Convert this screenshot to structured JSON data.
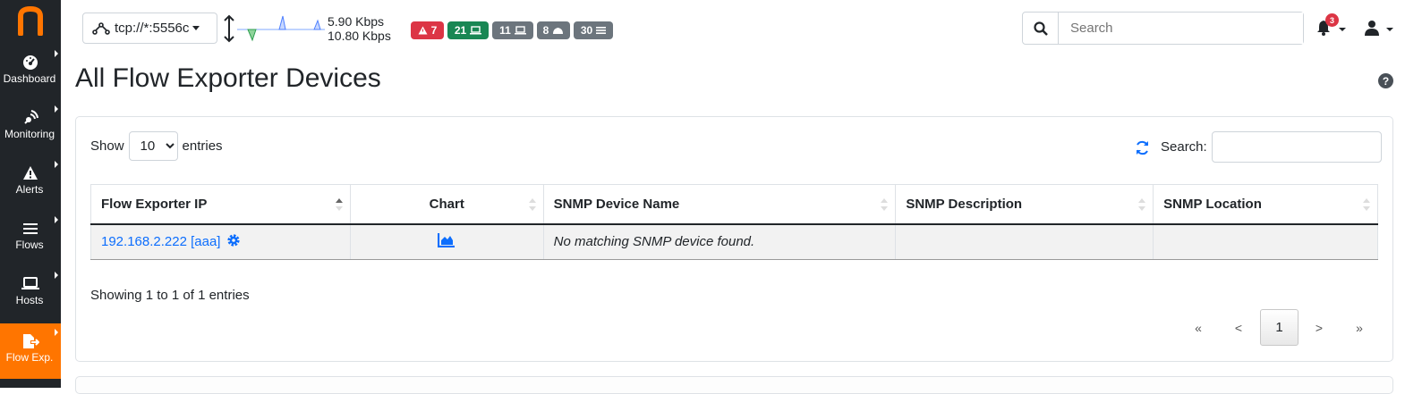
{
  "brand": {
    "logo_letter": "n",
    "accent": "#ff7500"
  },
  "sidebar": {
    "items": [
      {
        "label": "Dashboard",
        "icon": "gauge-icon"
      },
      {
        "label": "Monitoring",
        "icon": "radar-icon"
      },
      {
        "label": "Alerts",
        "icon": "warning-triangle-icon"
      },
      {
        "label": "Flows",
        "icon": "list-icon"
      },
      {
        "label": "Hosts",
        "icon": "laptop-icon"
      },
      {
        "label": "Flow Exp.",
        "icon": "file-export-icon",
        "active": true
      }
    ]
  },
  "topbar": {
    "interface": "tcp://*:5556c",
    "throughput_up": "5.90 Kbps",
    "throughput_down": "10.80 Kbps",
    "badges": [
      {
        "count": "7",
        "icon": "warning-triangle-icon",
        "color": "#dc3545"
      },
      {
        "count": "21",
        "icon": "laptop-icon",
        "color": "#198754"
      },
      {
        "count": "11",
        "icon": "laptop-icon",
        "color": "#6c757d"
      },
      {
        "count": "8",
        "icon": "cloud-icon",
        "color": "#6c757d"
      },
      {
        "count": "30",
        "icon": "list-icon",
        "color": "#6c757d"
      }
    ],
    "search_placeholder": "Search",
    "notifications": "3"
  },
  "page": {
    "title": "All Flow Exporter Devices",
    "help": "?"
  },
  "table_controls": {
    "show_label": "Show",
    "page_size": "10",
    "entries_label": "entries",
    "search_label": "Search:"
  },
  "table": {
    "columns": [
      "Flow Exporter IP",
      "Chart",
      "SNMP Device Name",
      "SNMP Description",
      "SNMP Location"
    ],
    "rows": [
      {
        "ip": "192.168.2.222 [aaa]",
        "device_name": "No matching SNMP device found.",
        "description": "",
        "location": ""
      }
    ]
  },
  "footer": {
    "info": "Showing 1 to 1 of 1 entries",
    "pagination": {
      "first": "«",
      "prev": "<",
      "current": "1",
      "next": ">",
      "last": "»"
    }
  }
}
